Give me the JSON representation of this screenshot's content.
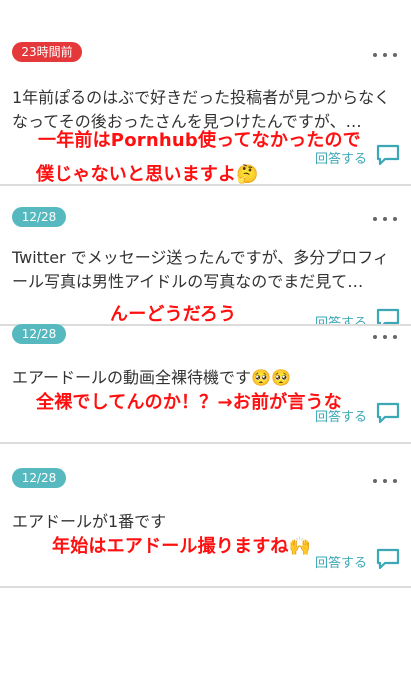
{
  "posts": [
    {
      "badge": "23時間前",
      "text": "1年前ぽるのはぶで好きだった投稿者が見つからなくなってその後おったさんを見つけたんですが、…",
      "annotation_line1": "一年前はPornhub使ってなかったので",
      "annotation_line2": "僕じゃないと思いますよ🤔",
      "reply_label": "回答する"
    },
    {
      "badge": "12/28",
      "text": "Twitter でメッセージ送ったんですが、多分プロフィール写真は男性アイドルの写真なのでまだ見て…",
      "annotation_line1": "んーどうだろう",
      "reply_label": "回答する"
    },
    {
      "badge": "12/28",
      "text": "エアードールの動画全裸待機です🥺🥺",
      "annotation_line1": "全裸でしてんのか！？→お前が言うな",
      "reply_label": "回答する"
    },
    {
      "badge": "12/28",
      "text": "エアドールが1番です",
      "annotation_line1": "年始はエアドール撮りますね🙌",
      "reply_label": "回答する"
    }
  ],
  "colors": {
    "badge_new": "#e5383b",
    "badge_date": "#55b9bf",
    "accent": "#3ca8b5",
    "annotation": "#ff1010"
  },
  "icons": {
    "more": "more-dots-icon",
    "reply": "speech-bubble-icon"
  }
}
